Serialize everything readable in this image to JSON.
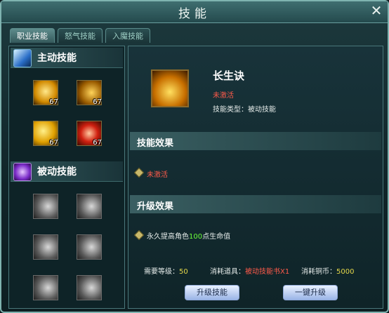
{
  "window": {
    "title": "技能",
    "close_glyph": "✕"
  },
  "tabs": [
    {
      "label": "职业技能",
      "active": true
    },
    {
      "label": "怒气技能",
      "active": false
    },
    {
      "label": "入魔技能",
      "active": false
    }
  ],
  "active_section": {
    "label": "主动技能",
    "icon": "blue-slash-icon",
    "skills": [
      {
        "icon": "golden-figure-skill-icon",
        "level": "67"
      },
      {
        "icon": "golden-crescent-skill-icon",
        "level": "67"
      },
      {
        "icon": "golden-claw-skill-icon",
        "level": "67"
      },
      {
        "icon": "red-swirl-skill-icon",
        "level": "67"
      }
    ]
  },
  "passive_section": {
    "label": "被动技能",
    "icon": "purple-shield-icon",
    "skills": [
      "gray-crescent-skill-icon",
      "gray-crescent-skill-icon",
      "gray-crescent-skill-icon",
      "gray-crescent-skill-icon",
      "gray-crescent-skill-icon",
      "gray-crescent-skill-icon"
    ]
  },
  "detail": {
    "skill_name": "长生诀",
    "status": "未激活",
    "type_line": "技能类型：被动技能",
    "effect_heading": "技能效果",
    "effect_text": "未激活",
    "upgrade_heading": "升级效果",
    "upgrade_pre": "永久提高角色",
    "upgrade_value": "100",
    "upgrade_post": "点生命值",
    "req_level_label": "需要等级：",
    "req_level_value": "50",
    "consume_item_label": "消耗道具：",
    "consume_item_value": "被动技能书X1",
    "consume_coin_label": "消耗铜币：",
    "consume_coin_value": "5000",
    "upgrade_button": "升级技能",
    "one_key_button": "一键升级"
  },
  "colors": {
    "accent_red": "#ff5a4a",
    "accent_green": "#6cff3a",
    "level_yellow": "#e6d84a"
  }
}
